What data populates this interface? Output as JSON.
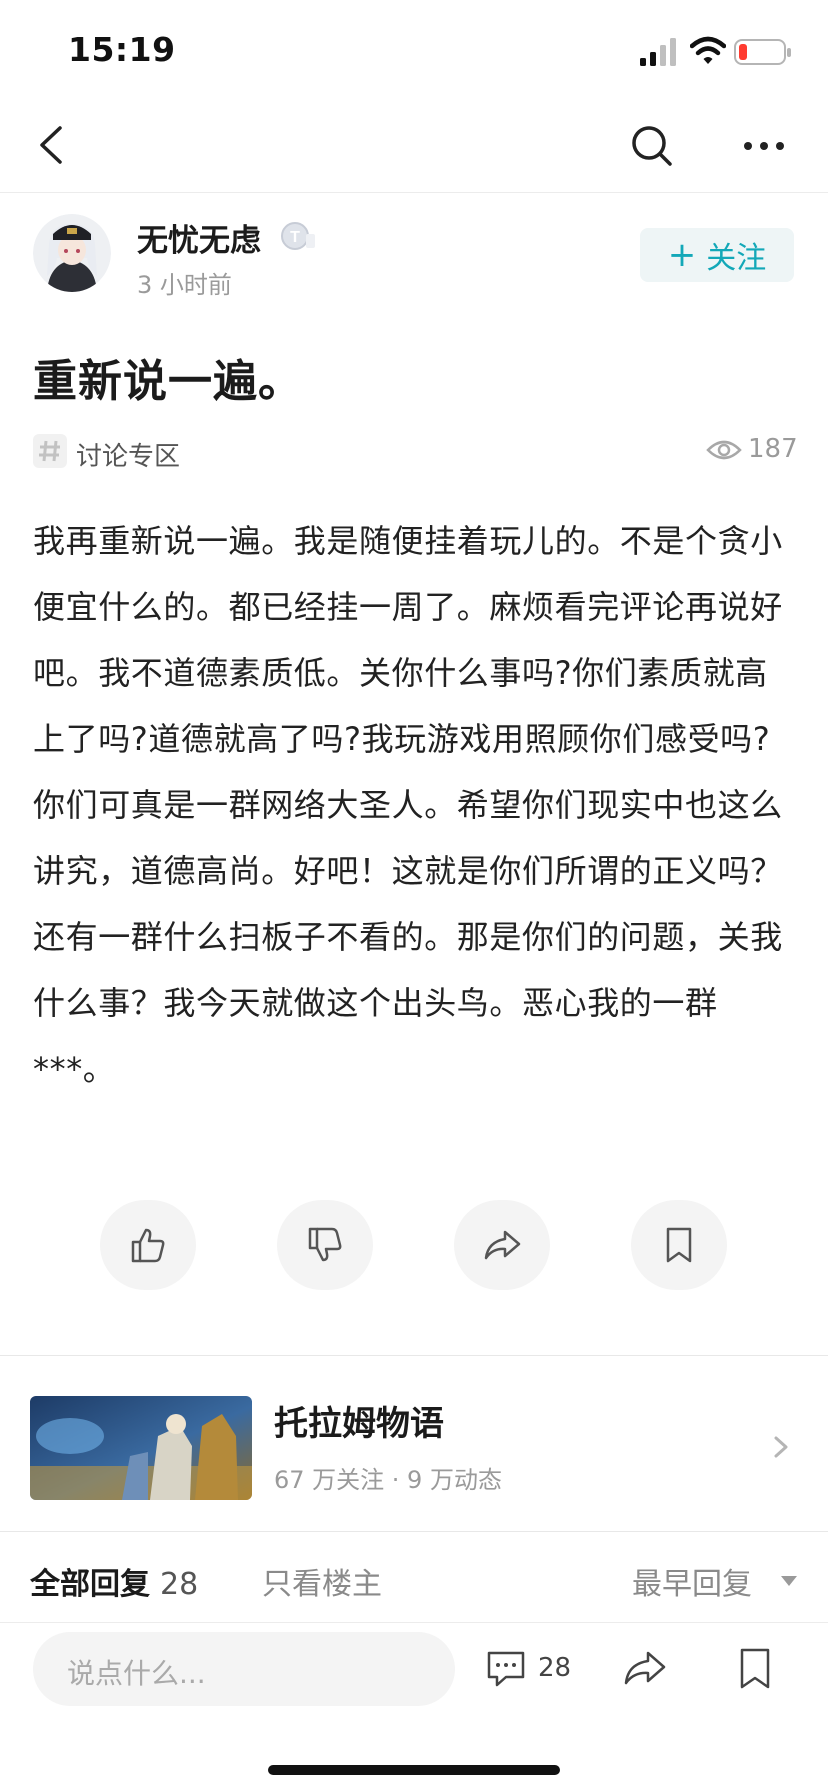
{
  "status_bar": {
    "time": "15:19",
    "battery_color": "#ff3b30"
  },
  "nav": {
    "icons": [
      "back-arrow-icon",
      "search-icon",
      "more-icon"
    ]
  },
  "author": {
    "name": "无忧无虑",
    "time_ago": "3 小时前",
    "level_badge": "T3",
    "follow_label": "关注",
    "follow_prefix": "+"
  },
  "post": {
    "title": "重新说一遍。",
    "topic": "讨论专区",
    "view_count": "187",
    "body": "我再重新说一遍。我是随便挂着玩儿的。不是个贪小便宜什么的。都已经挂一周了。麻烦看完评论再说好吧。我不道德素质低。关你什么事吗?你们素质就高上了吗?道德就高了吗?我玩游戏用照顾你们感受吗?你们可真是一群网络大圣人。希望你们现实中也这么讲究，道德高尚。好吧！这就是你们所谓的正义吗？还有一群什么扫板子不看的。那是你们的问题，关我什么事？我今天就做这个出头鸟。恶心我的一群***。"
  },
  "actions": [
    "thumbs-up-icon",
    "thumbs-down-icon",
    "share-icon",
    "bookmark-icon"
  ],
  "game": {
    "name": "托拉姆物语",
    "stats": "67 万关注 · 9 万动态"
  },
  "replies": {
    "all_label": "全部回复",
    "all_count": "28",
    "op_only_label": "只看楼主",
    "sort_label": "最早回复"
  },
  "bottom_bar": {
    "comment_placeholder": "说点什么...",
    "comment_count": "28"
  },
  "colors": {
    "accent": "#13a8b8",
    "follow_bg": "#eef5f6",
    "muted_text": "#9a9a9a"
  }
}
